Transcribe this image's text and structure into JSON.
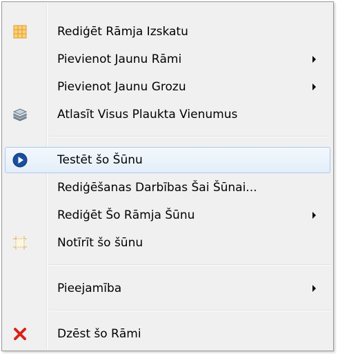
{
  "menu": {
    "items": [
      {
        "label": "Rediģēt Rāmja Izskatu",
        "icon": "grid-icon",
        "has_submenu": false
      },
      {
        "label": "Pievienot Jaunu Rāmi",
        "icon": "",
        "has_submenu": true
      },
      {
        "label": "Pievienot Jaunu Grozu",
        "icon": "",
        "has_submenu": true
      },
      {
        "label": "Atlasīt Visus Plaukta Vienumus",
        "icon": "stack-icon",
        "has_submenu": false
      },
      {
        "label": "Testēt šo Šūnu",
        "icon": "play-icon",
        "has_submenu": false,
        "highlighted": true
      },
      {
        "label": "Rediģēšanas Darbības Šai Šūnai...",
        "icon": "",
        "has_submenu": false
      },
      {
        "label": "Rediģēt Šo Rāmja Šūnu",
        "icon": "",
        "has_submenu": true
      },
      {
        "label": "Notīrīt šo šūnu",
        "icon": "clear-cell-icon",
        "has_submenu": false
      },
      {
        "label": "Pieejamība",
        "icon": "",
        "has_submenu": true
      },
      {
        "label": "Dzēst šo Rāmi",
        "icon": "delete-x-icon",
        "has_submenu": false
      }
    ]
  },
  "colors": {
    "menu_background": "#f0f0f0",
    "highlight_border": "#aac9ee",
    "play_icon": "#1a4f9c",
    "delete_icon": "#d8221a"
  }
}
